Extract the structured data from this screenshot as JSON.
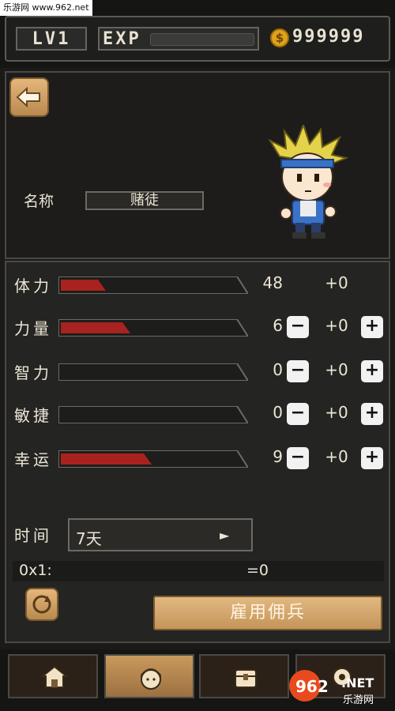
{
  "watermark_top": "乐游网 www.962.net",
  "header": {
    "level": "LV1",
    "exp_label": "EXP",
    "exp_progress": 0,
    "coin_icon": "coin-icon",
    "gold": "999999"
  },
  "character": {
    "name_label": "名称",
    "name_value": "赌徒"
  },
  "stats": [
    {
      "label": "体力",
      "value": "48",
      "bonus": "+0",
      "fill": 0.22,
      "adjustable": false
    },
    {
      "label": "力量",
      "value": "6",
      "bonus": "+0",
      "fill": 0.36,
      "adjustable": true
    },
    {
      "label": "智力",
      "value": "0",
      "bonus": "+0",
      "fill": 0,
      "adjustable": true
    },
    {
      "label": "敏捷",
      "value": "0",
      "bonus": "+0",
      "fill": 0,
      "adjustable": true
    },
    {
      "label": "幸运",
      "value": "9",
      "bonus": "+0",
      "fill": 0.48,
      "adjustable": true
    }
  ],
  "time": {
    "label": "时间",
    "value": "7天",
    "arrow": "►"
  },
  "cost": {
    "left": "0x1:",
    "right": "=0"
  },
  "hire_button": "雇用佣兵",
  "controls": {
    "minus": "−",
    "plus": "+"
  },
  "colors": {
    "bar_fill": "#a8231f",
    "bar_empty": "#222",
    "accent_button": "#d4a66b"
  },
  "bottom_nav": [
    {
      "name": "home",
      "icon": "house-icon"
    },
    {
      "name": "hero",
      "icon": "hero-face-icon"
    },
    {
      "name": "inventory",
      "icon": "chest-icon"
    },
    {
      "name": "settings",
      "icon": "gear-icon"
    }
  ],
  "watermark_bottom": {
    "logo": "962",
    "tld": ".NET",
    "site": "乐游网"
  }
}
